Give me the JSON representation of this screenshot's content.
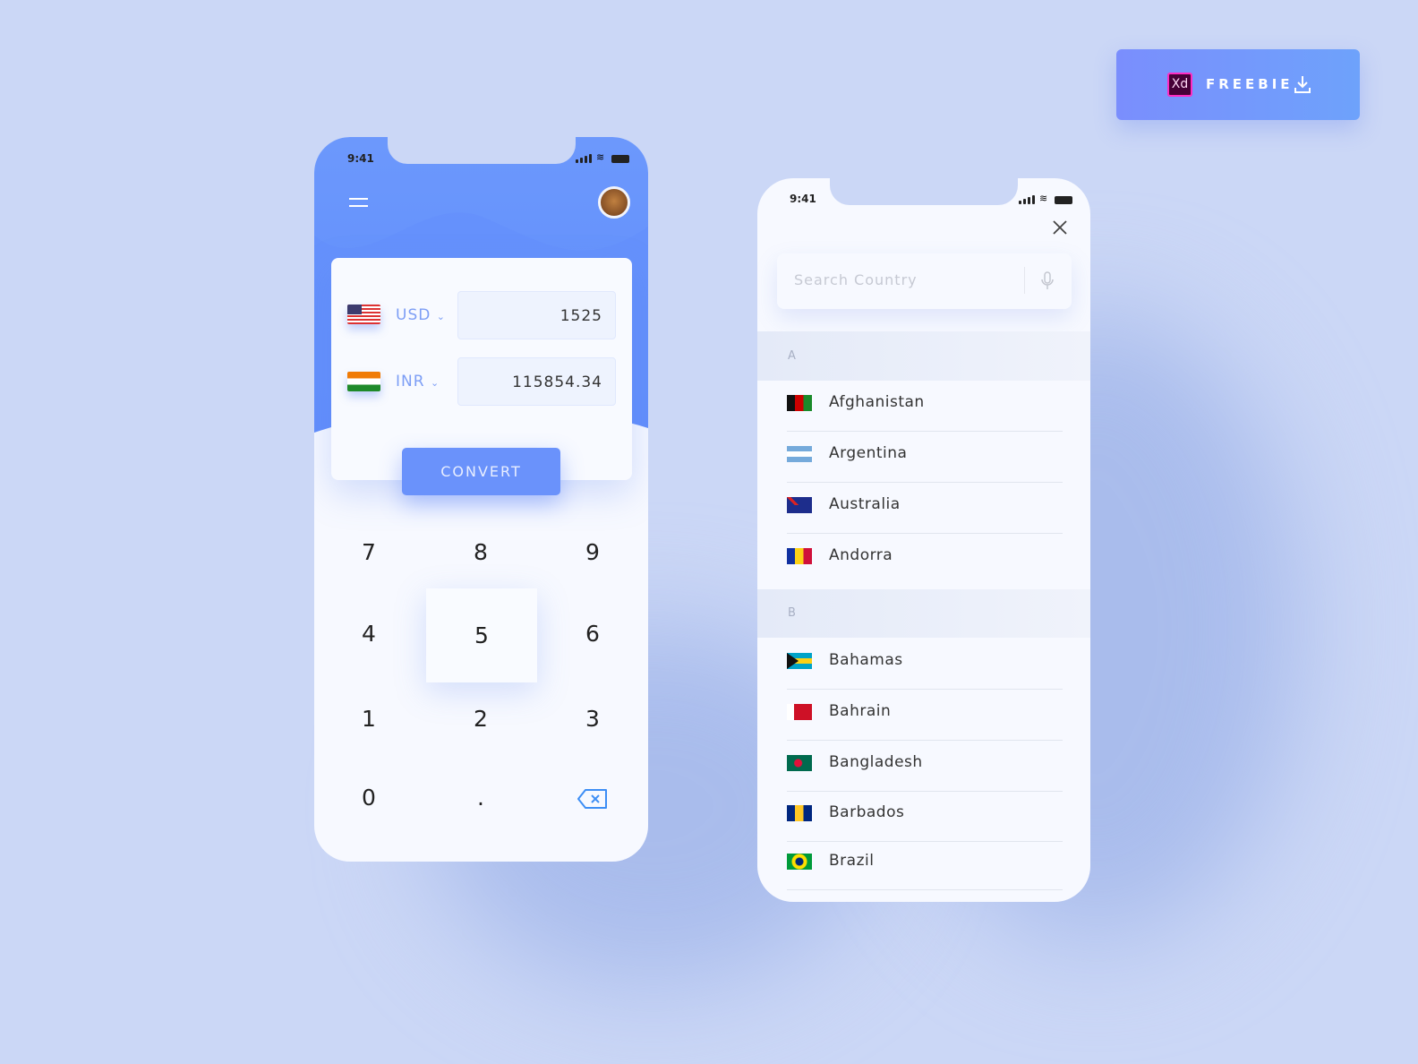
{
  "freebie": {
    "badge": "Xd",
    "label": "FREEBIE",
    "icon": "download-icon",
    "colors": [
      "#7a8efd",
      "#6ea2fb"
    ]
  },
  "converter": {
    "status": {
      "time": "9:41"
    },
    "menu_icon": "hamburger-icon",
    "avatar_icon": "user-avatar",
    "rows": [
      {
        "flag": "us-flag",
        "currency": "USD",
        "amount": "1525"
      },
      {
        "flag": "india-flag",
        "currency": "INR",
        "amount": "115854.34"
      }
    ],
    "convert_label": "CONVERT",
    "keys": [
      "7",
      "8",
      "9",
      "4",
      "5",
      "6",
      "1",
      "2",
      "3",
      "0",
      ".",
      "backspace-icon"
    ],
    "pressed_key": "5",
    "accent": "#6a92fb"
  },
  "country_picker": {
    "status": {
      "time": "9:41"
    },
    "search_placeholder": "Search Country",
    "sections": [
      {
        "letter": "A",
        "countries": [
          "Afghanistan",
          "Argentina",
          "Australia",
          "Andorra"
        ]
      },
      {
        "letter": "B",
        "countries": [
          "Bahamas",
          "Bahrain",
          "Bangladesh",
          "Barbados",
          "Brazil"
        ]
      }
    ]
  }
}
